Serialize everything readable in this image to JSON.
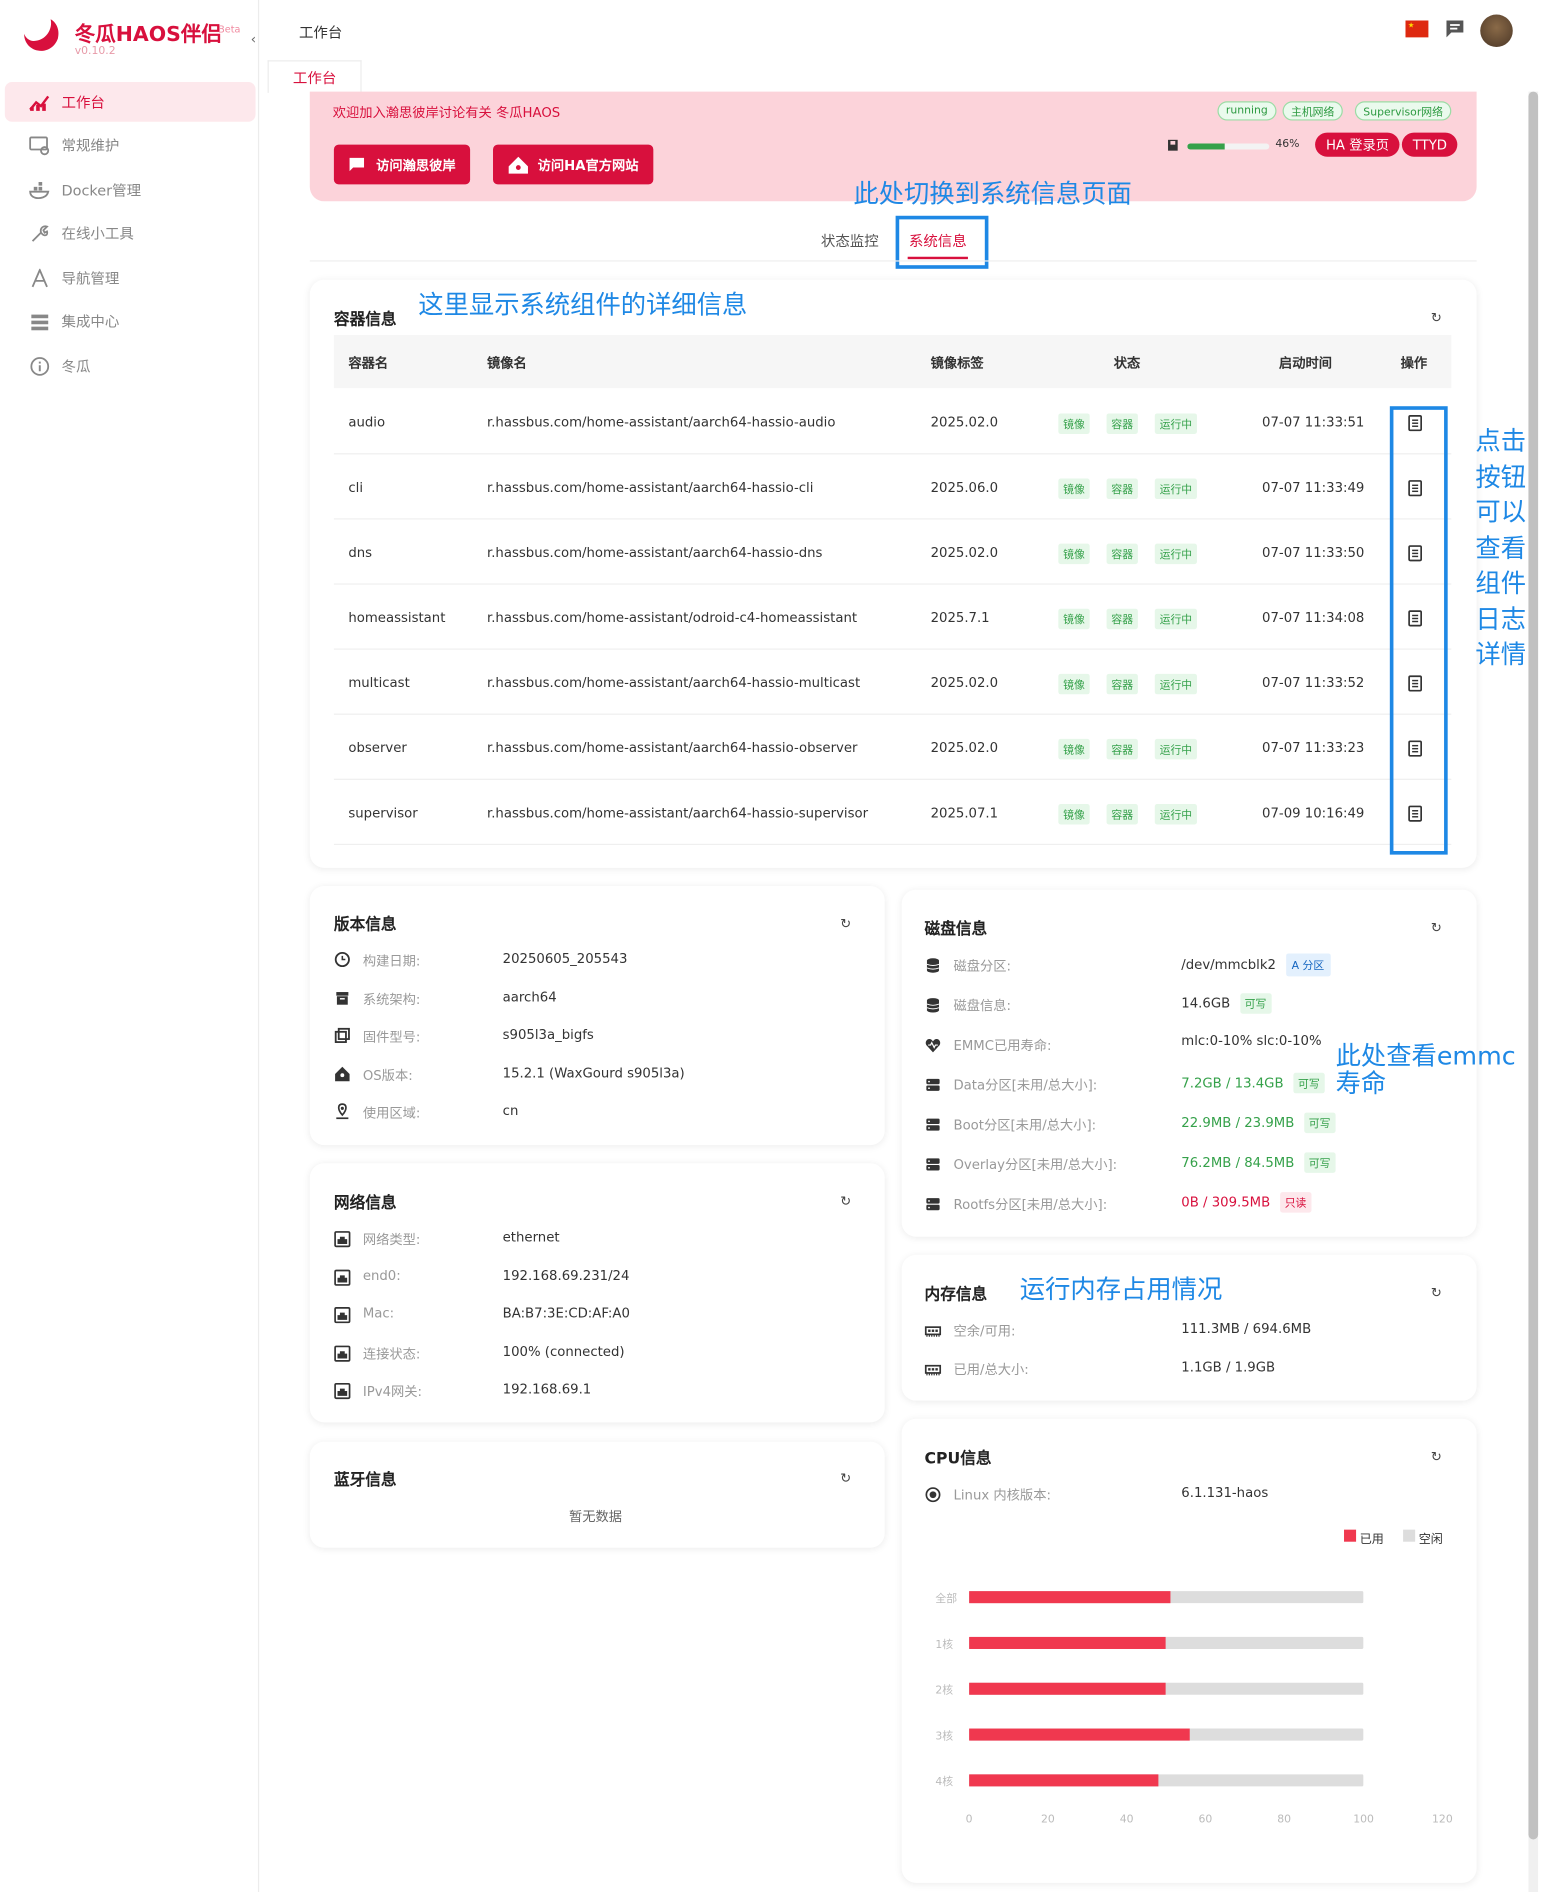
{
  "app": {
    "title": "冬瓜HAOS伴侣",
    "beta": "Beta",
    "version": "v0.10.2"
  },
  "sidebar": {
    "items": [
      {
        "label": "工作台",
        "icon": "dashboard-icon"
      },
      {
        "label": "常规维护",
        "icon": "maintenance-icon"
      },
      {
        "label": "Docker管理",
        "icon": "docker-icon"
      },
      {
        "label": "在线小工具",
        "icon": "wrench-icon"
      },
      {
        "label": "导航管理",
        "icon": "navigation-icon"
      },
      {
        "label": "集成中心",
        "icon": "integration-icon"
      },
      {
        "label": "冬瓜",
        "icon": "info-icon"
      }
    ]
  },
  "header": {
    "title": "工作台",
    "tab": "工作台"
  },
  "banner": {
    "text": "欢迎加入瀚思彼岸讨论有关 冬瓜HAOS",
    "btn_forum": "访问瀚思彼岸",
    "btn_ha": "访问HA官方网站",
    "badges": [
      "running",
      "主机网络",
      "Supervisor网络"
    ],
    "storage_pct": "46%",
    "storage_value": 46,
    "btn_login": "HA 登录页",
    "btn_ttyd": "TTYD"
  },
  "tabs": {
    "monitor": "状态监控",
    "sysinfo": "系统信息"
  },
  "annotations": {
    "switch": "此处切换到系统信息页面",
    "detail": "这里显示系统组件的详细信息",
    "logs": "点击按钮可以查看组件日志详情",
    "emmc": "此处查看emmc寿命",
    "memory": "运行内存占用情况"
  },
  "containers": {
    "title": "容器信息",
    "headers": [
      "容器名",
      "镜像名",
      "镜像标签",
      "状态",
      "启动时间",
      "操作"
    ],
    "status_tags": [
      "镜像",
      "容器",
      "运行中"
    ],
    "rows": [
      {
        "name": "audio",
        "image": "r.hassbus.com/home-assistant/aarch64-hassio-audio",
        "tag": "2025.02.0",
        "time": "07-07 11:33:51"
      },
      {
        "name": "cli",
        "image": "r.hassbus.com/home-assistant/aarch64-hassio-cli",
        "tag": "2025.06.0",
        "time": "07-07 11:33:49"
      },
      {
        "name": "dns",
        "image": "r.hassbus.com/home-assistant/aarch64-hassio-dns",
        "tag": "2025.02.0",
        "time": "07-07 11:33:50"
      },
      {
        "name": "homeassistant",
        "image": "r.hassbus.com/home-assistant/odroid-c4-homeassistant",
        "tag": "2025.7.1",
        "time": "07-07 11:34:08"
      },
      {
        "name": "multicast",
        "image": "r.hassbus.com/home-assistant/aarch64-hassio-multicast",
        "tag": "2025.02.0",
        "time": "07-07 11:33:52"
      },
      {
        "name": "observer",
        "image": "r.hassbus.com/home-assistant/aarch64-hassio-observer",
        "tag": "2025.02.0",
        "time": "07-07 11:33:23"
      },
      {
        "name": "supervisor",
        "image": "r.hassbus.com/home-assistant/aarch64-hassio-supervisor",
        "tag": "2025.07.1",
        "time": "07-09 10:16:49"
      }
    ]
  },
  "version": {
    "title": "版本信息",
    "rows": [
      {
        "label": "构建日期:",
        "value": "20250605_205543"
      },
      {
        "label": "系统架构:",
        "value": "aarch64"
      },
      {
        "label": "固件型号:",
        "value": "s905l3a_bigfs"
      },
      {
        "label": "OS版本:",
        "value": "15.2.1 (WaxGourd s905l3a)"
      },
      {
        "label": "使用区域:",
        "value": "cn"
      }
    ]
  },
  "network": {
    "title": "网络信息",
    "rows": [
      {
        "label": "网络类型:",
        "value": "ethernet"
      },
      {
        "label": "end0:",
        "value": "192.168.69.231/24"
      },
      {
        "label": "Mac:",
        "value": "BA:B7:3E:CD:AF:A0"
      },
      {
        "label": "连接状态:",
        "value": "100% (connected)"
      },
      {
        "label": "IPv4网关:",
        "value": "192.168.69.1"
      }
    ]
  },
  "bluetooth": {
    "title": "蓝牙信息",
    "empty": "暂无数据"
  },
  "disk": {
    "title": "磁盘信息",
    "rows": [
      {
        "label": "磁盘分区:",
        "value": "/dev/mmcblk2",
        "tag": "A 分区"
      },
      {
        "label": "磁盘信息:",
        "value": "14.6GB",
        "tag": "可写"
      },
      {
        "label": "EMMC已用寿命:",
        "value": "mlc:0-10%  slc:0-10%"
      },
      {
        "label": "Data分区[未用/总大小]:",
        "value": "7.2GB / 13.4GB",
        "tag": "可写"
      },
      {
        "label": "Boot分区[未用/总大小]:",
        "value": "22.9MB / 23.9MB",
        "tag": "可写"
      },
      {
        "label": "Overlay分区[未用/总大小]:",
        "value": "76.2MB / 84.5MB",
        "tag": "可写"
      },
      {
        "label": "Rootfs分区[未用/总大小]:",
        "value": "0B / 309.5MB",
        "tag": "只读"
      }
    ]
  },
  "memory": {
    "title": "内存信息",
    "rows": [
      {
        "label": "空余/可用:",
        "value": "111.3MB / 694.6MB"
      },
      {
        "label": "已用/总大小:",
        "value": "1.1GB / 1.9GB"
      }
    ]
  },
  "cpu": {
    "title": "CPU信息",
    "kernel_label": "Linux 内核版本:",
    "kernel_value": "6.1.131-haos",
    "legend_used": "已用",
    "legend_free": "空闲"
  },
  "chart_data": {
    "type": "bar",
    "orientation": "horizontal",
    "stacked": true,
    "categories": [
      "全部",
      "1核",
      "2核",
      "3核",
      "4核"
    ],
    "series": [
      {
        "name": "已用",
        "values": [
          51,
          50,
          50,
          56,
          48
        ],
        "color": "#f0384f"
      },
      {
        "name": "空闲",
        "values": [
          49,
          50,
          50,
          44,
          52
        ],
        "color": "#dddddd"
      }
    ],
    "xlim": [
      0,
      120
    ],
    "xticks": [
      0,
      20,
      40,
      60,
      80,
      100,
      120
    ],
    "legend": "top-right"
  },
  "colors": {
    "brand": "#d8103d",
    "accent_blue": "#1e88e5",
    "ok_green": "#35a14a"
  }
}
